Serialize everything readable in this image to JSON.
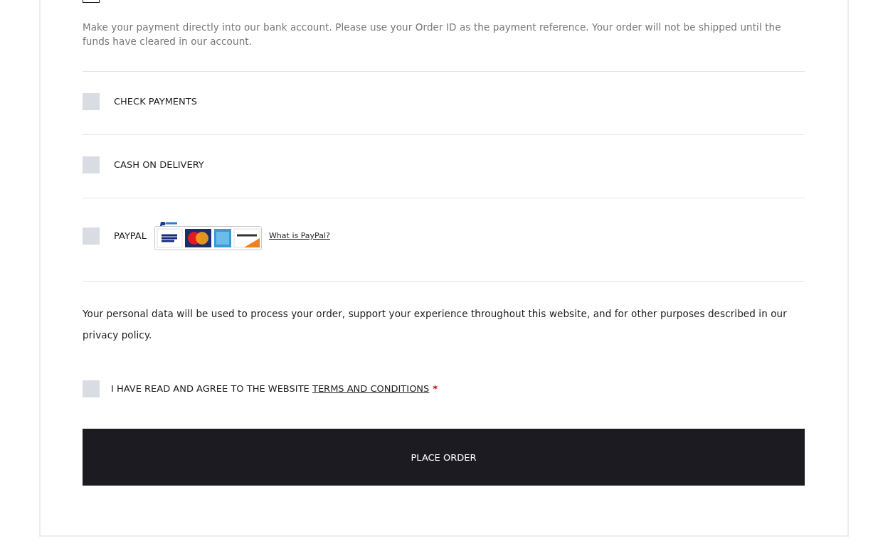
{
  "payment_methods": [
    {
      "kind": "description",
      "selected": true,
      "description": "Make your payment directly into our bank account. Please use your Order ID as the payment reference. Your order will not be shipped until the funds have cleared in our account."
    },
    {
      "kind": "plain",
      "label": "CHECK PAYMENTS",
      "selected": false
    },
    {
      "kind": "plain",
      "label": "CASH ON DELIVERY",
      "selected": false
    },
    {
      "kind": "logo",
      "label": "PAYPAL",
      "selected": false,
      "link": "What is PayPal?"
    }
  ],
  "privacy_notice": "Your personal data will be used to process your order, support your experience throughout this website, and for other purposes described in our privacy policy.",
  "terms": {
    "text": "I HAVE READ AND AGREE TO THE WEBSITE",
    "link": "TERMS AND CONDITIONS",
    "required_mark": "*",
    "checked": false
  },
  "place_order_button": "PLACE ORDER"
}
